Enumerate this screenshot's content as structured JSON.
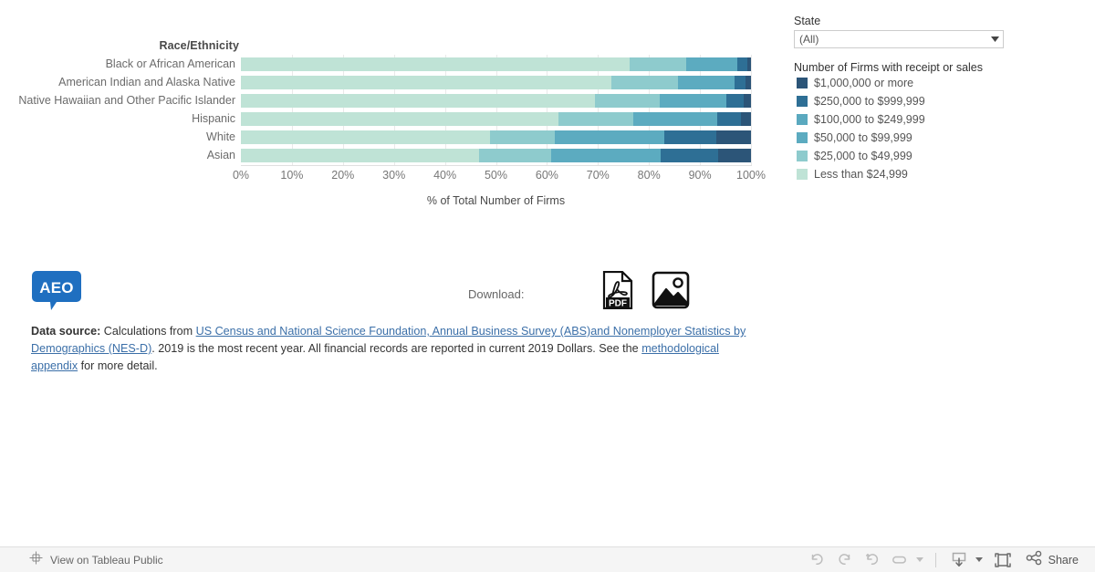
{
  "chart": {
    "row_field_title": "Race/Ethnicity",
    "x_axis_title": "% of Total Number of Firms",
    "tick_labels": [
      "0%",
      "10%",
      "20%",
      "30%",
      "40%",
      "50%",
      "60%",
      "70%",
      "80%",
      "90%",
      "100%"
    ]
  },
  "filter": {
    "label": "State",
    "value": "(All)",
    "caret_icon": "chevron-down-icon"
  },
  "legend": {
    "title": "Number of Firms with receipt or sales",
    "items": [
      {
        "label": "$1,000,000 or more",
        "color": "#2c5578"
      },
      {
        "label": "$250,000 to $999,999",
        "color": "#2e6f95"
      },
      {
        "label": "$100,000 to $249,999",
        "color": "#5aa9bf"
      },
      {
        "label": "$50,000 to $99,999",
        "color": "#5cabc0"
      },
      {
        "label": "$25,000 to $49,999",
        "color": "#8ecbcd"
      },
      {
        "label": "Less than $24,999",
        "color": "#bfe3d6"
      }
    ]
  },
  "download": {
    "label": "Download:",
    "pdf_icon": "pdf-file-icon",
    "image_icon": "image-file-icon"
  },
  "logo": {
    "text": "AEO",
    "color": "#1f6fc0"
  },
  "footnote": {
    "prefix_bold": "Data source:",
    "text_1": " Calculations from ",
    "link_1": "US Census and National Science Foundation, Annual Business Survey (ABS)and Nonemployer Statistics by Demographics (NES-D)",
    "text_2": ". 2019 is the most recent year. All financial records are reported in current 2019 Dollars. See the ",
    "link_2": "methodological appendix",
    "text_3": " for more detail."
  },
  "toolbar": {
    "tableau_label": "View on Tableau Public",
    "tableau_icon": "tableau-logo-icon",
    "undo_icon": "undo-icon",
    "redo_icon": "redo-icon",
    "revert_icon": "revert-icon",
    "refresh_icon": "refresh-icon",
    "pause_caret_icon": "chevron-down-icon",
    "download_icon": "download-icon",
    "download_caret_icon": "chevron-down-icon",
    "fullscreen_icon": "fullscreen-icon",
    "share_icon": "share-icon",
    "share_label": "Share"
  },
  "chart_data": {
    "type": "bar",
    "subtype": "stacked-horizontal-100pct",
    "title": "",
    "xlabel": "% of Total Number of Firms",
    "ylabel": "Race/Ethnicity",
    "xlim": [
      0,
      100
    ],
    "grid": true,
    "legend_position": "right",
    "categories": [
      "Black or African American",
      "American Indian and Alaska Native",
      "Native Hawaiian and Other Pacific Islander",
      "Hispanic",
      "White",
      "Asian"
    ],
    "series": [
      {
        "name": "Less than $24,999",
        "color": "#bfe3d6",
        "values": [
          76.2,
          72.6,
          69.4,
          62.3,
          48.8,
          46.7
        ]
      },
      {
        "name": "$25,000 to $49,999",
        "color": "#8ecbcd",
        "values": [
          11.1,
          13.1,
          12.8,
          14.7,
          12.7,
          14.1
        ]
      },
      {
        "name": "$50,000 to $99,999",
        "color": "#5cabc0",
        "values": [
          10.0,
          11.0,
          13.0,
          16.3,
          21.5,
          21.5
        ]
      },
      {
        "name": "$100,000 to $249,999",
        "color": "#5aa9bf",
        "values": [
          0.0,
          0.0,
          0.0,
          0.0,
          0.0,
          0.0
        ]
      },
      {
        "name": "$250,000 to $999,999",
        "color": "#2e6f95",
        "values": [
          2.0,
          2.2,
          3.4,
          4.8,
          10.2,
          11.3
        ]
      },
      {
        "name": "$1,000,000 or more",
        "color": "#2c5578",
        "values": [
          0.7,
          1.1,
          1.4,
          1.9,
          6.8,
          6.4
        ]
      }
    ]
  }
}
